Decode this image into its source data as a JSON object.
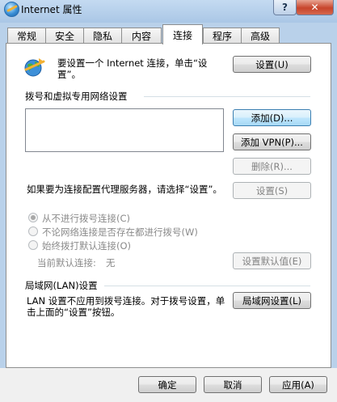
{
  "window": {
    "title": "Internet 属性",
    "help_label": "?",
    "close_label": "✕"
  },
  "tabs": [
    {
      "label": "常规"
    },
    {
      "label": "安全"
    },
    {
      "label": "隐私"
    },
    {
      "label": "内容"
    },
    {
      "label": "连接"
    },
    {
      "label": "程序"
    },
    {
      "label": "高级"
    }
  ],
  "active_tab": "连接",
  "setup": {
    "text": "要设置一个 Internet 连接，单击“设置”。",
    "button": "设置(U)"
  },
  "dialup": {
    "heading": "拨号和虚拟专用网络设置",
    "add_button": "添加(D)...",
    "add_vpn_button": "添加 VPN(P)...",
    "remove_button": "删除(R)...",
    "proxy_text": "如果要为连接配置代理服务器，请选择“设置”。",
    "settings_button": "设置(S)",
    "options": [
      {
        "label": "从不进行拨号连接(C)",
        "checked": true
      },
      {
        "label": "不论网络连接是否存在都进行拨号(W)",
        "checked": false
      },
      {
        "label": "始终拨打默认连接(O)",
        "checked": false
      }
    ],
    "default_label": "当前默认连接:",
    "default_value": "无",
    "set_default_button": "设置默认值(E)"
  },
  "lan": {
    "heading": "局域网(LAN)设置",
    "text": "LAN 设置不应用到拨号连接。对于拨号设置，单击上面的“设置”按钮。",
    "button": "局域网设置(L)"
  },
  "footer": {
    "ok": "确定",
    "cancel": "取消",
    "apply": "应用(A)"
  }
}
